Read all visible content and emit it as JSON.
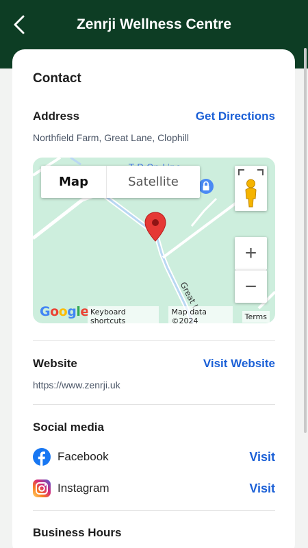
{
  "header": {
    "title": "Zenrji Wellness Centre",
    "back_icon": "chevron-left-icon",
    "background_color": "#0d3d24"
  },
  "contact": {
    "title": "Contact",
    "address": {
      "label": "Address",
      "action": "Get Directions",
      "value": "Northfield Farm, Great Lane, Clophill"
    },
    "map": {
      "tabs": [
        "Map",
        "Satellite"
      ],
      "selected_tab": "Map",
      "place_label": "T   D     On-Line",
      "road_label": "Great L",
      "zoom_in": "+",
      "zoom_out": "−",
      "logo": "Google",
      "footer": {
        "shortcuts": "Keyboard shortcuts",
        "attribution": "Map data ©2024",
        "terms": "Terms"
      }
    },
    "website": {
      "label": "Website",
      "action": "Visit Website",
      "value": "https://www.zenrji.uk"
    },
    "social": {
      "label": "Social media",
      "items": [
        {
          "name": "Facebook",
          "action": "Visit",
          "icon": "facebook-icon"
        },
        {
          "name": "Instagram",
          "action": "Visit",
          "icon": "instagram-icon"
        }
      ]
    },
    "hours": {
      "label": "Business Hours"
    }
  },
  "colors": {
    "link": "#1a5fd6",
    "map_background": "#cdeedd",
    "pin": "#e53935"
  }
}
